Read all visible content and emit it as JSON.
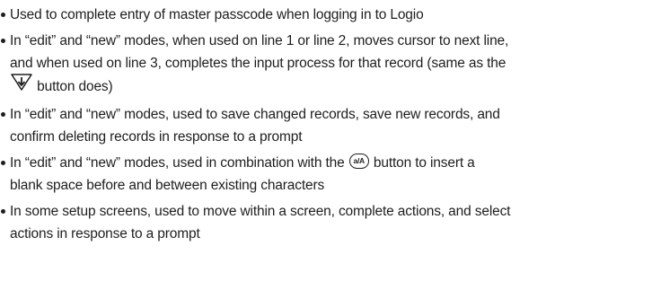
{
  "bullets": [
    {
      "text": "Used to complete entry of master passcode when logging in to Logio"
    },
    {
      "line1": "In “edit” and “new” modes, when used on line 1 or line 2, moves cursor to next line,",
      "line2": "and when used on line 3, completes the input process for that record (same as the",
      "line3_after_icon": " button does)",
      "icon": "down-arrow-triangle-icon"
    },
    {
      "line1": "In “edit” and “new” modes, used to save changed records, save new records, and",
      "line2": "confirm deleting records in response to a prompt"
    },
    {
      "line1_before_icon": "In “edit” and “new” modes, used in combination with the ",
      "icon_label": "a/A",
      "line1_after_icon": " button to insert a",
      "line2": "blank space before and between existing characters"
    },
    {
      "line1": "In some setup screens, used to move within a screen, complete actions, and select",
      "line2": "actions in response to a prompt"
    }
  ]
}
